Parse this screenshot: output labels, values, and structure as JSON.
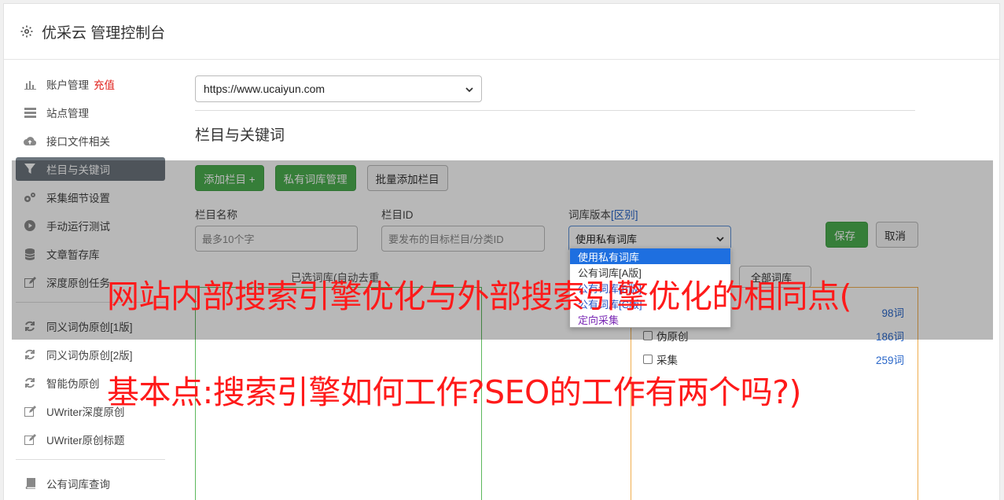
{
  "app": {
    "title": "优采云 管理控制台"
  },
  "sidebar": {
    "items": [
      {
        "label": "账户管理",
        "badge": "充值",
        "icon": "bar-chart-icon"
      },
      {
        "label": "站点管理",
        "icon": "server-icon"
      },
      {
        "label": "接口文件相关",
        "icon": "cloud-upload-icon"
      },
      {
        "label": "栏目与关键词",
        "icon": "filter-icon",
        "active": true
      },
      {
        "label": "采集细节设置",
        "icon": "gears-icon"
      },
      {
        "label": "手动运行测试",
        "icon": "play-circle-icon"
      },
      {
        "label": "文章暂存库",
        "icon": "database-icon"
      },
      {
        "label": "深度原创任务",
        "icon": "edit-icon"
      },
      {
        "label": "同义词伪原创[1版]",
        "icon": "refresh-icon"
      },
      {
        "label": "同义词伪原创[2版]",
        "icon": "refresh-icon"
      },
      {
        "label": "智能伪原创",
        "icon": "refresh-icon"
      },
      {
        "label": "UWriter深度原创",
        "icon": "edit-icon"
      },
      {
        "label": "UWriter原创标题",
        "icon": "edit-icon"
      },
      {
        "label": "公有词库查询",
        "icon": "book-icon"
      }
    ]
  },
  "main": {
    "site_select": {
      "value": "https://www.ucaiyun.com"
    },
    "section_title": "栏目与关键词",
    "buttons": {
      "add_column": "添加栏目 +",
      "private_lib": "私有词库管理",
      "batch_add": "批量添加栏目"
    },
    "fields": {
      "column_name": {
        "label": "栏目名称",
        "placeholder": "最多10个字"
      },
      "column_id": {
        "label": "栏目ID",
        "placeholder": "要发布的目标栏目/分类ID"
      },
      "lib_version": {
        "label": "词库版本",
        "link": "[区别]",
        "value": "使用私有词库"
      }
    },
    "dropdown_options": [
      "使用私有词库",
      "公有词库[A版]",
      "公有词库[B版]",
      "公有词库[C版]",
      "定向采集"
    ],
    "save": "保存",
    "cancel": "取消",
    "hint": "已选词库(自动去重",
    "all_libs": "全部词库",
    "libs": [
      {
        "name": "",
        "count": "98词"
      },
      {
        "name": "伪原创",
        "count": "186词"
      },
      {
        "name": "采集",
        "count": "259词"
      }
    ]
  },
  "watermark": {
    "line1": "网站内部搜索引擎优化与外部搜索引擎优化的相同点(",
    "line2": "基本点:搜索引擎如何工作?SEO的工作有两个吗?)"
  },
  "colors": {
    "accent_green": "#4caf50",
    "active_gray": "#6c757d",
    "link_blue": "#2a67c9",
    "watermark_red": "#ff1a1a"
  }
}
